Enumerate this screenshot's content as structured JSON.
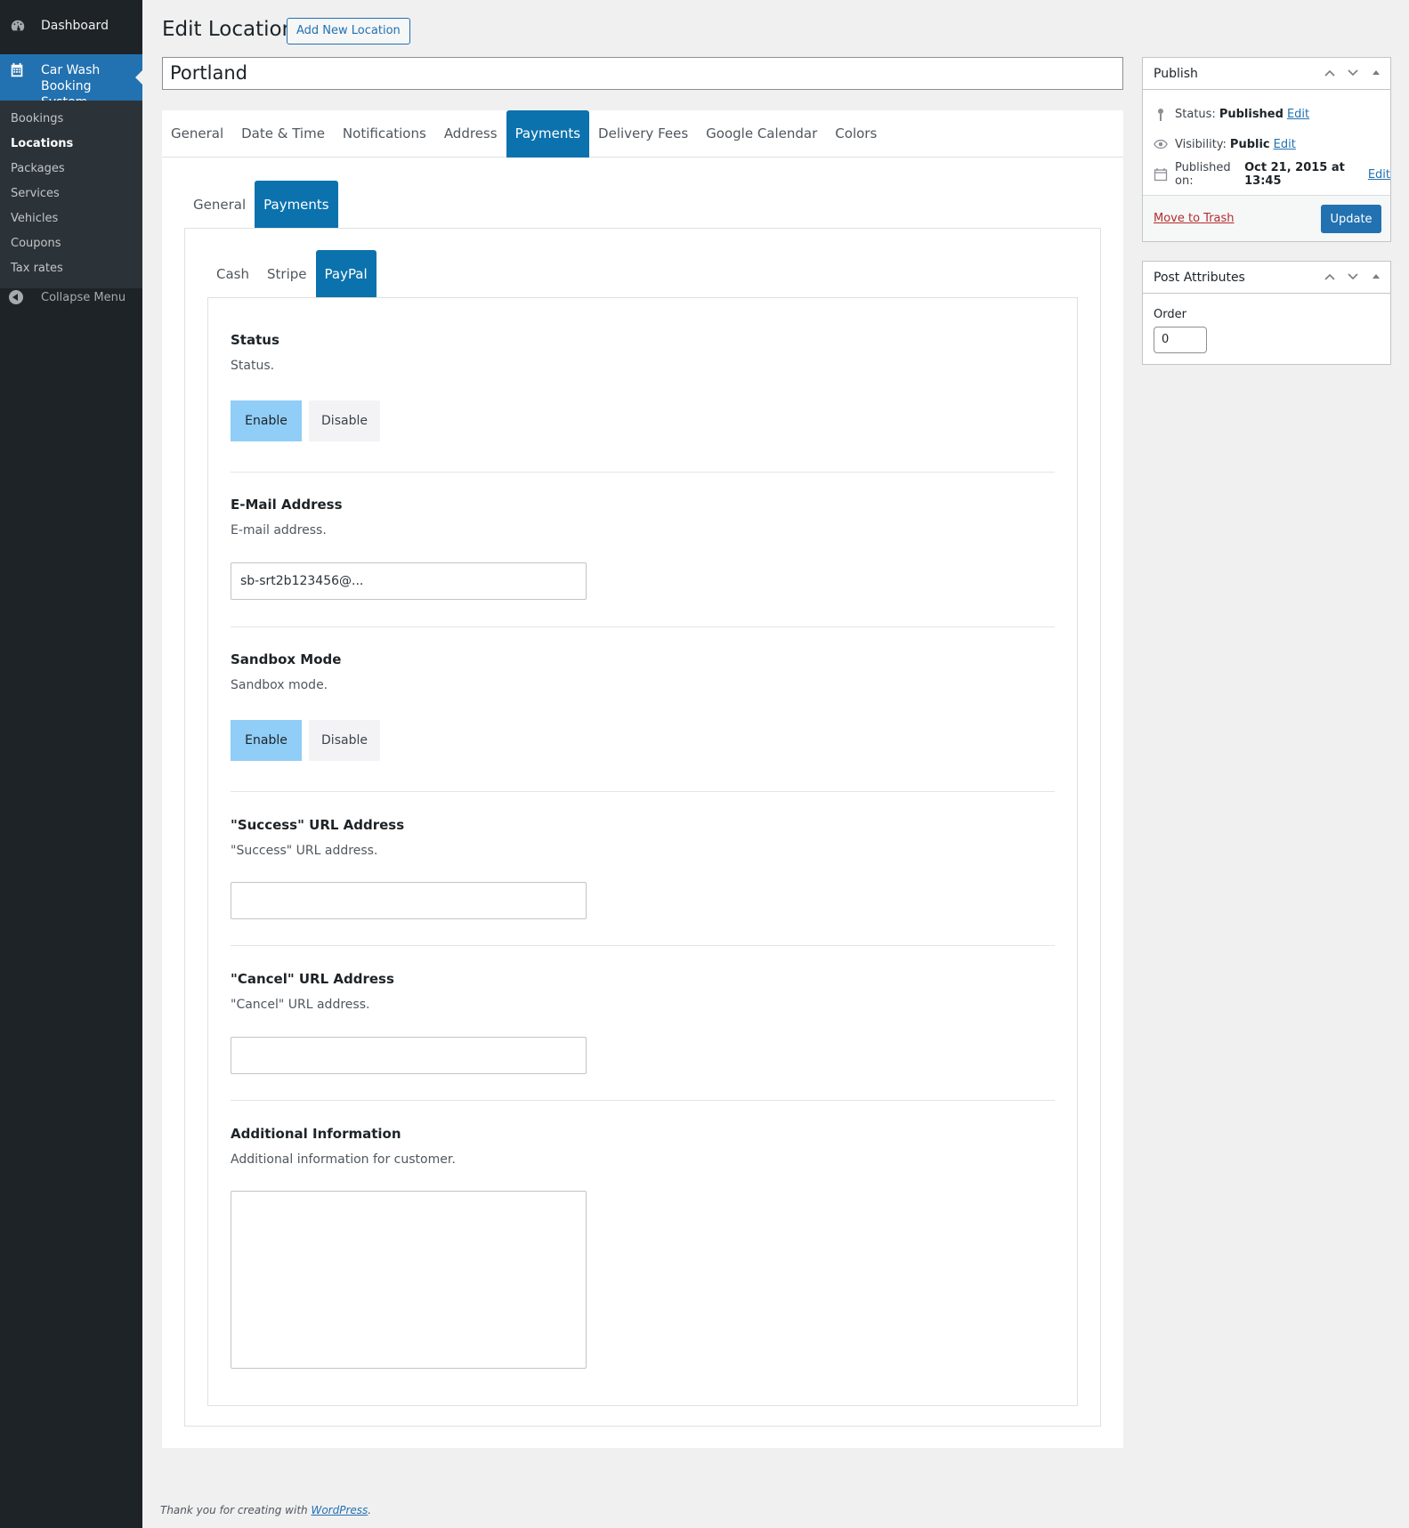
{
  "sidebar": {
    "dashboard": "Dashboard",
    "current_menu": "Car Wash Booking System",
    "submenu": [
      "Bookings",
      "Locations",
      "Packages",
      "Services",
      "Vehicles",
      "Coupons",
      "Tax rates"
    ],
    "collapse": "Collapse Menu"
  },
  "header": {
    "title": "Edit Location",
    "add_new": "Add New Location"
  },
  "post_title": "Portland",
  "tabs": {
    "top": [
      "General",
      "Date & Time",
      "Notifications",
      "Address",
      "Payments",
      "Delivery Fees",
      "Google Calendar",
      "Colors"
    ],
    "top_active": "Payments",
    "second": [
      "General",
      "Payments"
    ],
    "third": [
      "Cash",
      "Stripe",
      "PayPal"
    ]
  },
  "paypal": {
    "status": {
      "label": "Status",
      "desc": "Status.",
      "enable": "Enable",
      "disable": "Disable",
      "selected": "Enable"
    },
    "email": {
      "label": "E-Mail Address",
      "desc": "E-mail address.",
      "value": "sb-srt2b123456@..."
    },
    "sandbox": {
      "label": "Sandbox Mode",
      "desc": "Sandbox mode.",
      "enable": "Enable",
      "disable": "Disable",
      "selected": "Enable"
    },
    "success_url": {
      "label": "\"Success\" URL Address",
      "desc": "\"Success\" URL address.",
      "value": ""
    },
    "cancel_url": {
      "label": "\"Cancel\" URL Address",
      "desc": "\"Cancel\" URL address.",
      "value": ""
    },
    "additional": {
      "label": "Additional Information",
      "desc": "Additional information for customer.",
      "value": ""
    }
  },
  "publish": {
    "title": "Publish",
    "status_label": "Status:",
    "status_value": "Published",
    "visibility_label": "Visibility:",
    "visibility_value": "Public",
    "published_label": "Published on:",
    "published_value": "Oct 21, 2015 at 13:45",
    "edit": "Edit",
    "trash": "Move to Trash",
    "update": "Update"
  },
  "attributes": {
    "title": "Post Attributes",
    "order_label": "Order",
    "order_value": "0"
  },
  "footer": {
    "text": "Thank you for creating with",
    "link": "WordPress",
    "period": "."
  },
  "colors": {
    "admin_bg": "#1d2327",
    "accent": "#2271b1",
    "active_tab": "#0b72ad",
    "selected_option": "#90cdf7"
  }
}
